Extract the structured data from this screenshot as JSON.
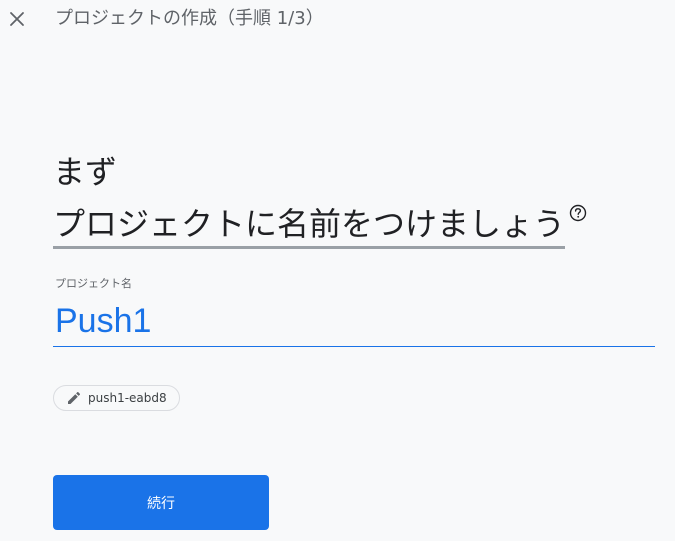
{
  "header": {
    "close_icon": "close-icon",
    "title": "プロジェクトの作成（手順 1/3）"
  },
  "headline": {
    "line1": "まず",
    "line2": "プロジェクトに名前をつけましょう",
    "help_icon": "help-circle-icon"
  },
  "project_name": {
    "label": "プロジェクト名",
    "value": "Push1"
  },
  "project_id_chip": {
    "icon": "pencil-icon",
    "text": "push1-eabd8"
  },
  "actions": {
    "continue_label": "続行"
  },
  "colors": {
    "accent": "#1a73e8",
    "background": "#f8f9fa",
    "text_primary": "#202124",
    "text_secondary": "#5f6368"
  }
}
